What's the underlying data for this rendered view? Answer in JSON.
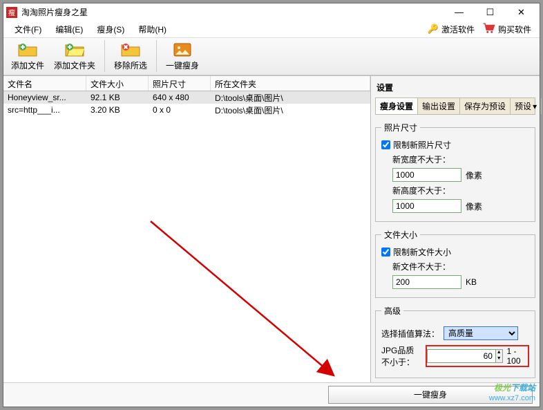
{
  "title": "淘淘照片瘦身之星",
  "menu": {
    "file": "文件(F)",
    "edit": "编辑(E)",
    "slim": "瘦身(S)",
    "help": "帮助(H)",
    "activate": "激活软件",
    "buy": "购买软件"
  },
  "toolbar": {
    "add_file": "添加文件",
    "add_folder": "添加文件夹",
    "remove_sel": "移除所选",
    "one_key": "一键瘦身"
  },
  "columns": {
    "name": "文件名",
    "size": "文件大小",
    "dim": "照片尺寸",
    "folder": "所在文件夹"
  },
  "rows": [
    {
      "name": "Honeyview_sr...",
      "size": "92.1 KB",
      "dim": "640 x 480",
      "folder": "D:\\tools\\桌面\\图片\\"
    },
    {
      "name": "src=http___i...",
      "size": "3.20 KB",
      "dim": "0 x 0",
      "folder": "D:\\tools\\桌面\\图片\\"
    }
  ],
  "settings": {
    "title": "设置",
    "tabs": {
      "slim": "瘦身设置",
      "output": "输出设置",
      "save_preset": "保存为预设",
      "preset": "预设"
    },
    "photo_size": {
      "legend": "照片尺寸",
      "limit_label": "限制新照片尺寸",
      "width_label": "新宽度不大于：",
      "width_value": "1000",
      "width_unit": "像素",
      "height_label": "新高度不大于：",
      "height_value": "1000",
      "height_unit": "像素"
    },
    "file_size": {
      "legend": "文件大小",
      "limit_label": "限制新文件大小",
      "file_label": "新文件不大于：",
      "file_value": "200",
      "file_unit": "KB"
    },
    "advanced": {
      "legend": "高级",
      "interp_label": "选择插值算法：",
      "interp_value": "高质量",
      "jpg_label": "JPG品质不小于：",
      "jpg_value": "60",
      "jpg_range": "1 - 100"
    }
  },
  "bottom": {
    "one_key": "一键瘦身"
  },
  "watermark": {
    "line1a": "极光",
    "line1b": "下载站",
    "line2": "www.xz7.com"
  }
}
